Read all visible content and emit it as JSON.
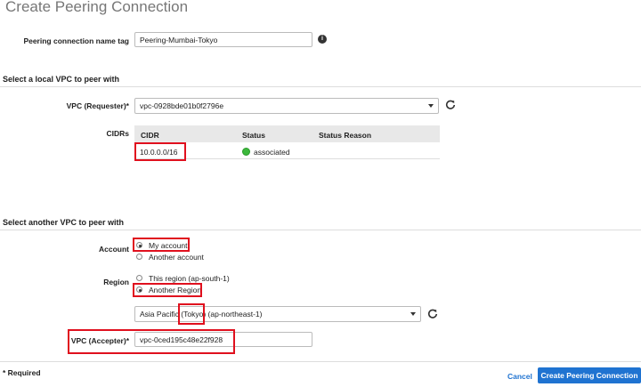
{
  "page": {
    "title": "Create Peering Connection"
  },
  "name_tag": {
    "label": "Peering connection name tag",
    "value": "Peering-Mumbai-Tokyo"
  },
  "local": {
    "section_title": "Select a local VPC to peer with",
    "vpc_label": "VPC (Requester)*",
    "vpc_value": "vpc-0928bde01b0f2796e",
    "cidrs_label": "CIDRs",
    "table": {
      "headers": [
        "CIDR",
        "Status",
        "Status Reason"
      ],
      "rows": [
        {
          "cidr": "10.0.0.0/16",
          "status": "associated",
          "reason": ""
        }
      ]
    }
  },
  "another": {
    "section_title": "Select another VPC to peer with",
    "account_label": "Account",
    "account_options": [
      "My account",
      "Another account"
    ],
    "account_selected": "My account",
    "region_label": "Region",
    "region_options": [
      "This region (ap-south-1)",
      "Another Region"
    ],
    "region_selected": "Another Region",
    "region_select": {
      "prefix": "Asia Pacific ",
      "highlight": "(Tokyo)",
      "suffix": " (ap-northeast-1)"
    },
    "vpc_label": "VPC (Accepter)*",
    "vpc_value": "vpc-0ced195c48e22f928"
  },
  "footer": {
    "required_note": "* Required",
    "cancel_label": "Cancel",
    "create_label": "Create Peering Connection"
  },
  "colors": {
    "accent": "#1f73d1",
    "highlight": "#e0101e",
    "status_ok": "#3cb83c"
  }
}
